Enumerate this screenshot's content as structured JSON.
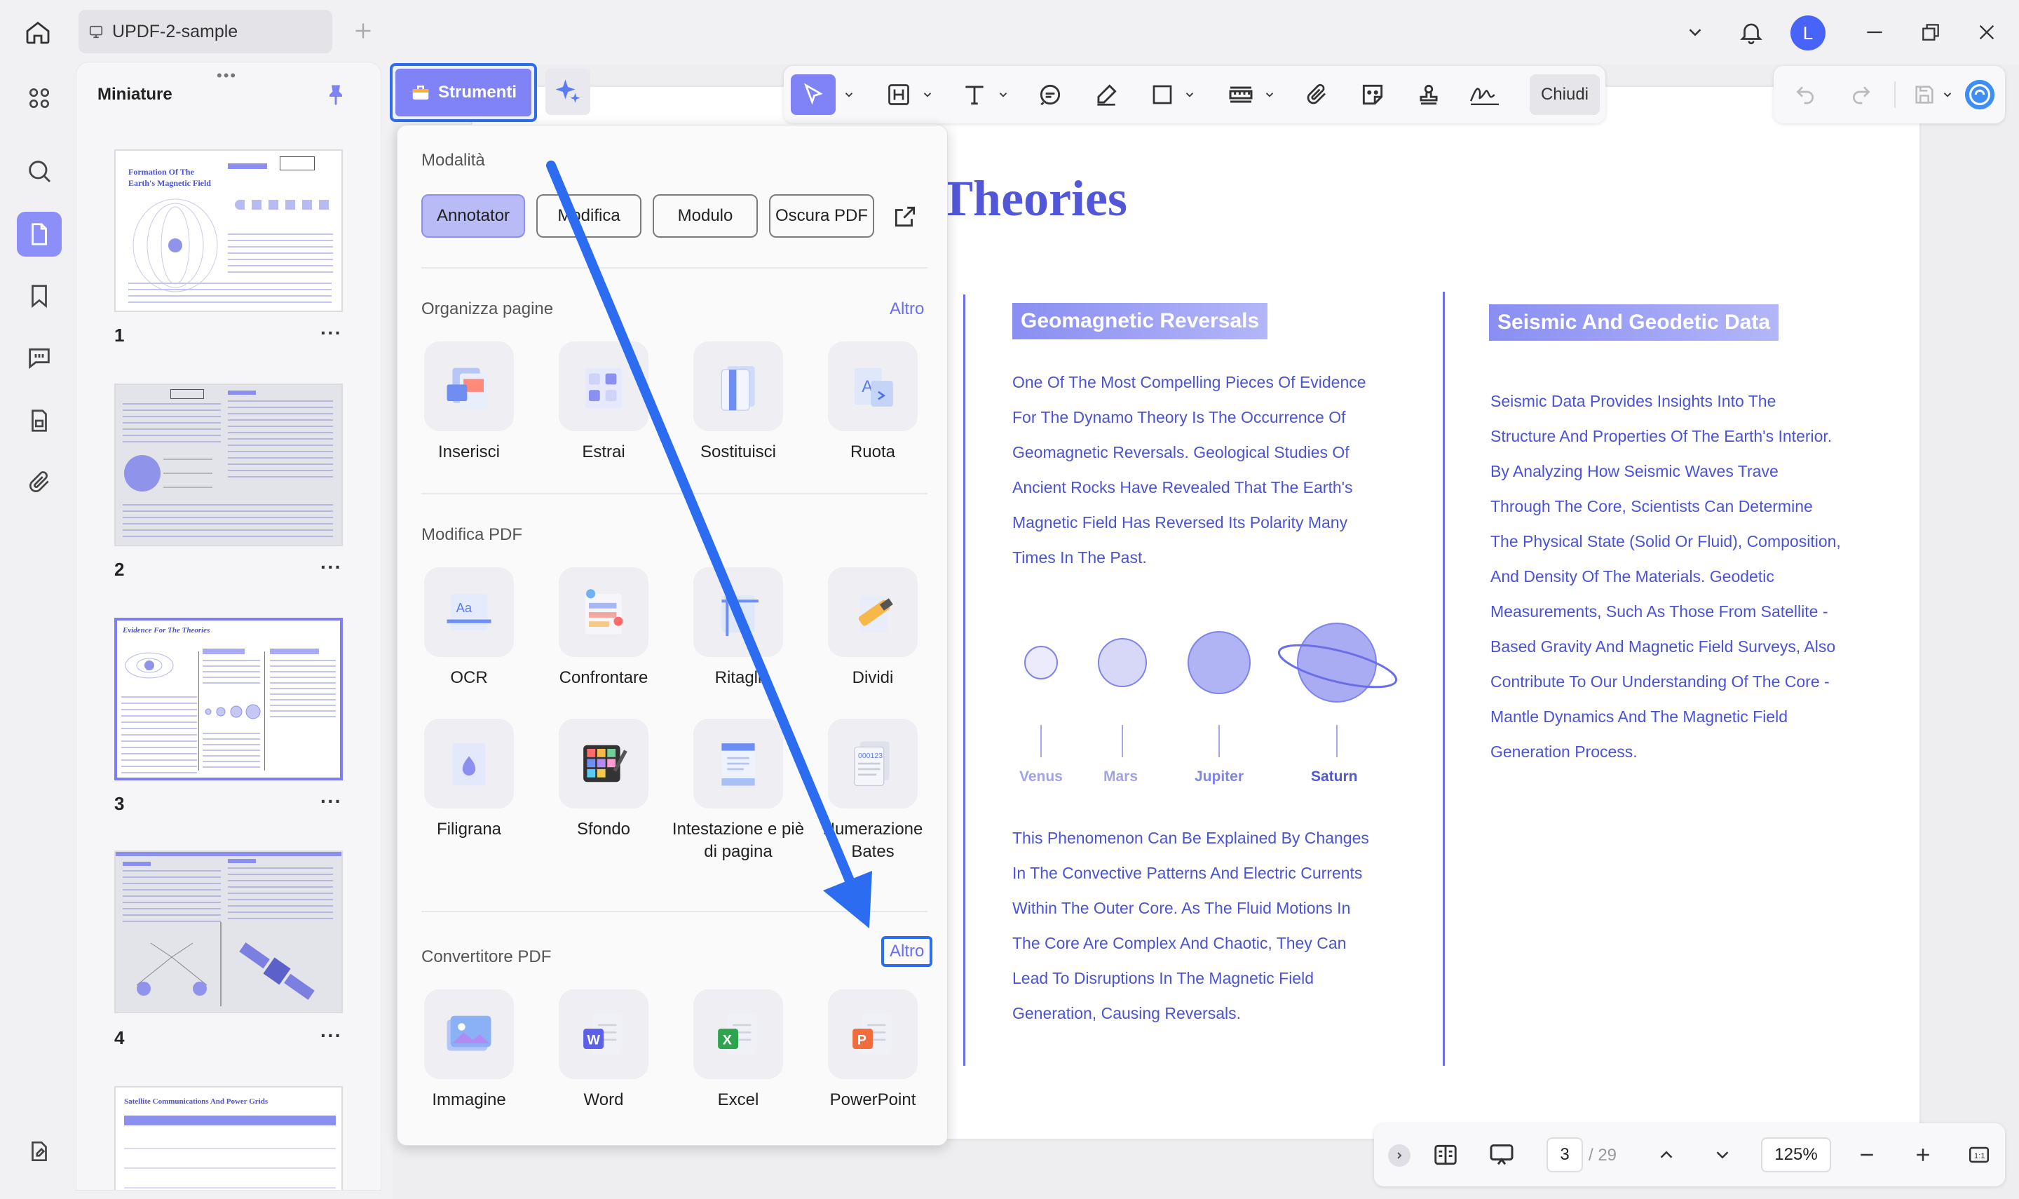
{
  "titlebar": {
    "doc_tab": "UPDF-2-sample",
    "avatar_letter": "L"
  },
  "thumbnails": {
    "title": "Miniature",
    "pages": [
      {
        "num": "1",
        "title": "Formation Of The Earth's Magnetic Field"
      },
      {
        "num": "2",
        "title": ""
      },
      {
        "num": "3",
        "title": "Evidence For The Theories"
      },
      {
        "num": "4",
        "title": ""
      },
      {
        "num": "",
        "title": "Satellite Communications And Power Grids"
      }
    ],
    "more": "···"
  },
  "tabs": {
    "strumenti": "Strumenti"
  },
  "toolbar": {
    "close": "Chiudi"
  },
  "menu": {
    "modes_title": "Modalità",
    "modes": [
      "Annotator",
      "Modifica",
      "Modulo",
      "Oscura PDF"
    ],
    "organize_title": "Organizza pagine",
    "organize_more": "Altro",
    "organize_tools": [
      "Inserisci",
      "Estrai",
      "Sostituisci",
      "Ruota"
    ],
    "edit_title": "Modifica PDF",
    "edit_tools": [
      "OCR",
      "Confrontare",
      "Ritagli",
      "Dividi"
    ],
    "edit_tools2": [
      "Filigrana",
      "Sfondo",
      "Intestazione e piè di pagina",
      "Numerazione Bates"
    ],
    "convert_title": "Convertitore PDF",
    "convert_more": "Altro",
    "convert_tools": [
      "Immagine",
      "Word",
      "Excel",
      "PowerPoint"
    ]
  },
  "document": {
    "title": "Theories",
    "sec1_title": "Geomagnetic Reversals",
    "sec1_lines": [
      "One Of The Most Compelling Pieces Of Evidence",
      "For The Dynamo Theory Is The Occurrence Of",
      "Geomagnetic Reversals. Geological Studies Of",
      "Ancient Rocks Have Revealed That The Earth's",
      "Magnetic Field Has Reversed Its Polarity Many",
      "Times In The Past."
    ],
    "planets": [
      "Venus",
      "Mars",
      "Jupiter",
      "Saturn"
    ],
    "sec1b_lines": [
      "This Phenomenon Can Be Explained By Changes",
      "In The Convective Patterns And Electric Currents",
      "Within The Outer Core. As The Fluid Motions In",
      "The Core Are Complex And Chaotic, They Can",
      "Lead To Disruptions In The Magnetic Field",
      "Generation, Causing Reversals."
    ],
    "sec2_title": "Seismic And Geodetic Data",
    "sec2_lines": [
      "Seismic Data Provides Insights Into The",
      "Structure And Properties Of The Earth's Interior.",
      "By Analyzing How Seismic Waves Trave",
      "Through The Core, Scientists Can Determine",
      "The Physical State (Solid Or Fluid), Composition,",
      "And Density Of The Materials. Geodetic",
      "Measurements, Such As Those From Satellite -",
      "Based Gravity And Magnetic Field Surveys, Also",
      "Contribute To Our Understanding Of The Core -",
      "Mantle Dynamics And The Magnetic Field",
      "Generation Process."
    ]
  },
  "bottombar": {
    "page_current": "3",
    "page_total": "/ 29",
    "zoom": "125%"
  },
  "colors": {
    "accent": "#7f83f5",
    "doc_text": "#4a52d6",
    "highlight_border": "#2b6cf0"
  }
}
